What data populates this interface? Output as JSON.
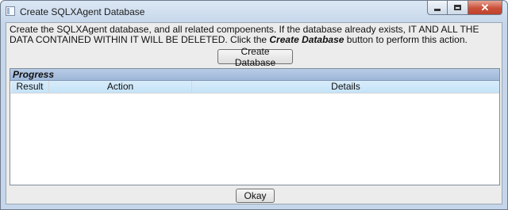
{
  "window": {
    "title": "Create SQLXAgent Database",
    "controls": {
      "minimize": "minimize",
      "maximize": "maximize",
      "close": "✕"
    }
  },
  "description": {
    "text_before": "Create the SQLXAgent database, and all related compoenents. If the database already exists, IT AND ALL THE DATA CONTAINED WITHIN IT WILL BE DELETED. Click the ",
    "emphasis": "Create Database",
    "text_after": " button to perform this action."
  },
  "create_button": {
    "label": "Create Database"
  },
  "progress": {
    "title": "Progress",
    "columns": {
      "result": "Result",
      "action": "Action",
      "details": "Details"
    },
    "rows": []
  },
  "ok_button": {
    "label": "Okay"
  }
}
